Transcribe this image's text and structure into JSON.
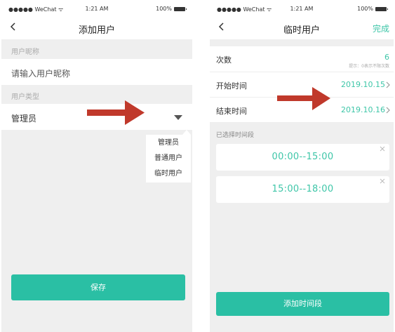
{
  "colors": {
    "accent": "#2abfa4",
    "accent_text": "#3ec6a8",
    "background": "#efefef",
    "annotation_arrow": "#c0392b"
  },
  "left": {
    "statusbar": {
      "carrier": "●●●●● WeChat ᯤ",
      "time": "1:21 AM",
      "battery": "100%"
    },
    "navbar": {
      "back_icon": "chevron-left-icon",
      "title": "添加用户"
    },
    "nickname": {
      "label": "用户昵称",
      "placeholder": "请输入用户昵称"
    },
    "user_type": {
      "label": "用户类型",
      "selected": "管理员",
      "caret_icon": "triangle-down-icon"
    },
    "dropdown": {
      "options": [
        "管理员",
        "普通用户",
        "临时用户"
      ]
    },
    "save_button": "保存"
  },
  "right": {
    "statusbar": {
      "carrier": "●●●●● WeChat ᯤ",
      "time": "1:21 AM",
      "battery": "100%"
    },
    "navbar": {
      "back_icon": "chevron-left-icon",
      "title": "临时用户",
      "done": "完成"
    },
    "count": {
      "label": "次数",
      "value": "6",
      "hint": "提示：0表示不限次数"
    },
    "start_time": {
      "label": "开始时间",
      "value": "2019.10.15"
    },
    "end_time": {
      "label": "结束时间",
      "value": "2019.10.16"
    },
    "selected_section": "已选择时间段",
    "time_ranges": [
      "00:00--15:00",
      "15:00--18:00"
    ],
    "add_button": "添加时间段"
  }
}
